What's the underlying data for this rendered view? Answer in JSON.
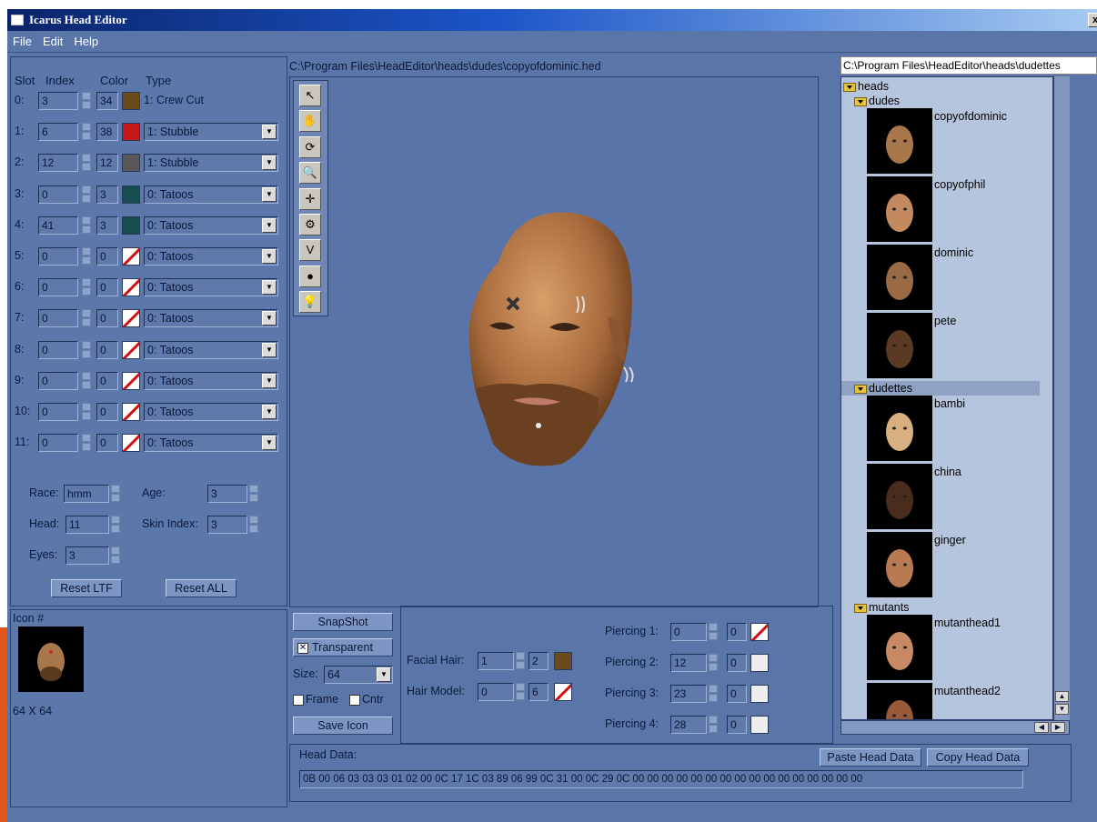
{
  "window": {
    "title": "Icarus Head Editor",
    "close": "x"
  },
  "menu": [
    "File",
    "Edit",
    "Help"
  ],
  "slots": {
    "headers": {
      "slot": "Slot",
      "index": "Index",
      "color": "Color",
      "type": "Type"
    },
    "rows": [
      {
        "slot": "0:",
        "index": "3",
        "color": "34",
        "swatch": "#6b4a1e",
        "type": "1: Crew Cut",
        "dropdown": false
      },
      {
        "slot": "1:",
        "index": "6",
        "color": "38",
        "swatch": "#c41818",
        "type": "1: Stubble",
        "dropdown": true
      },
      {
        "slot": "2:",
        "index": "12",
        "color": "12",
        "swatch": "#595656",
        "type": "1: Stubble",
        "dropdown": true
      },
      {
        "slot": "3:",
        "index": "0",
        "color": "3",
        "swatch": "#174d4f",
        "type": "0: Tatoos",
        "dropdown": true
      },
      {
        "slot": "4:",
        "index": "41",
        "color": "3",
        "swatch": "#174d4f",
        "type": "0: Tatoos",
        "dropdown": true
      },
      {
        "slot": "5:",
        "index": "0",
        "color": "0",
        "swatch": "none",
        "type": "0: Tatoos",
        "dropdown": true
      },
      {
        "slot": "6:",
        "index": "0",
        "color": "0",
        "swatch": "none",
        "type": "0: Tatoos",
        "dropdown": true
      },
      {
        "slot": "7:",
        "index": "0",
        "color": "0",
        "swatch": "none",
        "type": "0: Tatoos",
        "dropdown": true
      },
      {
        "slot": "8:",
        "index": "0",
        "color": "0",
        "swatch": "none",
        "type": "0: Tatoos",
        "dropdown": true
      },
      {
        "slot": "9:",
        "index": "0",
        "color": "0",
        "swatch": "none",
        "type": "0: Tatoos",
        "dropdown": true
      },
      {
        "slot": "10:",
        "index": "0",
        "color": "0",
        "swatch": "none",
        "type": "0: Tatoos",
        "dropdown": true
      },
      {
        "slot": "11:",
        "index": "0",
        "color": "0",
        "swatch": "none",
        "type": "0: Tatoos",
        "dropdown": true
      }
    ]
  },
  "attrs": {
    "race_label": "Race:",
    "race": "hmm",
    "age_label": "Age:",
    "age": "3",
    "head_label": "Head:",
    "head": "11",
    "skin_label": "Skin Index:",
    "skin": "3",
    "eyes_label": "Eyes:",
    "eyes": "3",
    "reset_ltf": "Reset LTF",
    "reset_all": "Reset ALL"
  },
  "icon": {
    "label": "Icon #",
    "size": "64 X 64"
  },
  "viewport": {
    "path": "C:\\Program Files\\HeadEditor\\heads\\dudes\\copyofdominic.hed"
  },
  "tools": [
    "arrow-tool-icon",
    "hand-pan-icon",
    "rotate-icon",
    "zoom-icon",
    "fit-view-icon",
    "light-orbit-icon",
    "vertex-icon",
    "sphere-icon",
    "light-lock-icon"
  ],
  "snapshot": {
    "snap": "SnapShot",
    "transparent": "Transparent",
    "transparent_checked": true,
    "size_label": "Size:",
    "size": "64",
    "frame": "Frame",
    "cntr": "Cntr",
    "save": "Save Icon"
  },
  "facial": {
    "facial_label": "Facial Hair:",
    "facial_index": "1",
    "facial_color": "2",
    "facial_swatch": "#6b4a1e",
    "hair_label": "Hair Model:",
    "hair_index": "0",
    "hair_color": "6"
  },
  "piercings": [
    {
      "label": "Piercing 1:",
      "index": "0",
      "color": "0",
      "swatch": "none"
    },
    {
      "label": "Piercing 2:",
      "index": "12",
      "color": "0",
      "swatch": "#eeeeee"
    },
    {
      "label": "Piercing 3:",
      "index": "23",
      "color": "0",
      "swatch": "#eeeeee"
    },
    {
      "label": "Piercing 4:",
      "index": "28",
      "color": "0",
      "swatch": "#eeeeee"
    }
  ],
  "headdata": {
    "label": "Head Data:",
    "paste": "Paste Head Data",
    "copy": "Copy Head Data",
    "value": "0B 00 06 03 03 03 01 02 00 0C 17 1C 03 89 06 99 0C 31 00 0C 29 0C 00 00 00 00 00 00 00 00 00 00 00 00 00 00 00 00"
  },
  "browser": {
    "path": "C:\\Program Files\\HeadEditor\\heads\\dudettes",
    "root": "heads",
    "folders": [
      {
        "name": "dudes",
        "items": [
          "copyofdominic",
          "copyofphil",
          "dominic",
          "pete"
        ]
      },
      {
        "name": "dudettes",
        "items": [
          "bambi",
          "china",
          "ginger"
        ]
      },
      {
        "name": "mutants",
        "items": [
          "mutanthead1",
          "mutanthead2"
        ]
      }
    ]
  }
}
